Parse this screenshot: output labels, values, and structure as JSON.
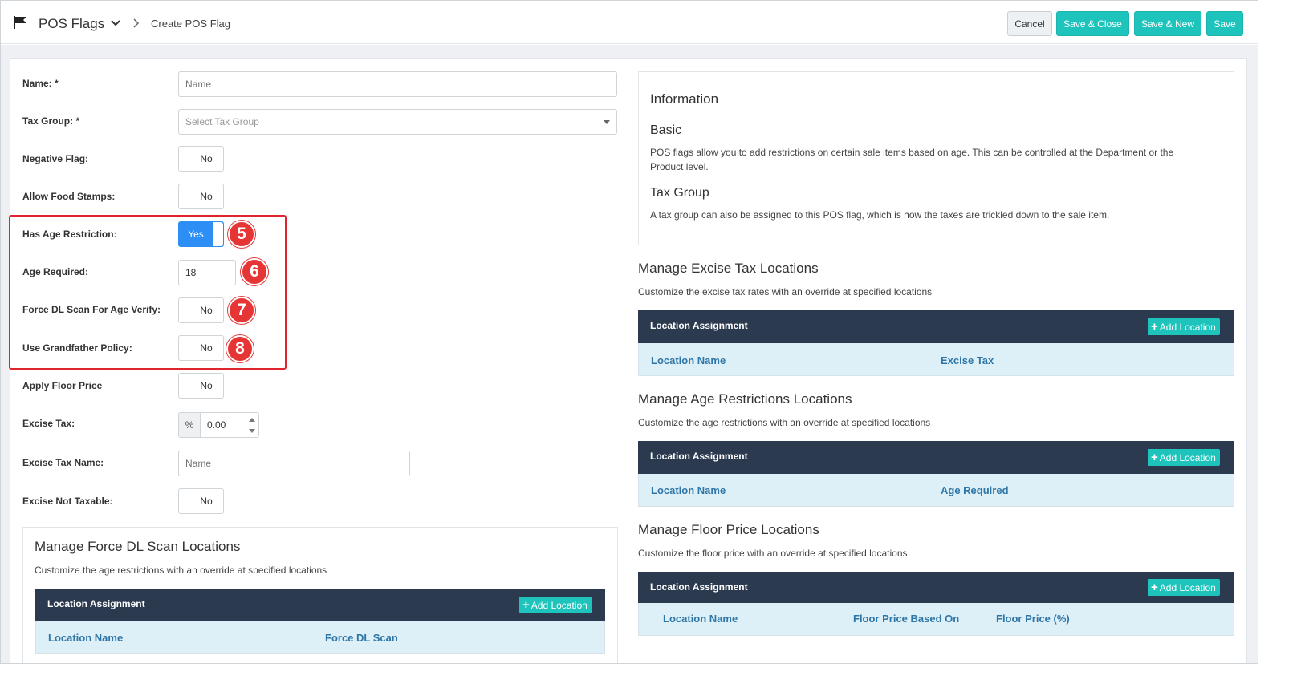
{
  "header": {
    "module_title": "POS Flags",
    "breadcrumb_page": "Create POS Flag",
    "buttons": {
      "cancel": "Cancel",
      "save_close": "Save & Close",
      "save_new": "Save & New",
      "save": "Save"
    }
  },
  "form": {
    "name": {
      "label": "Name: *",
      "placeholder": "Name"
    },
    "tax_group": {
      "label": "Tax Group: *",
      "placeholder": "Select Tax Group"
    },
    "negative_flag": {
      "label": "Negative Flag:",
      "value": "No"
    },
    "allow_food_stamps": {
      "label": "Allow Food Stamps:",
      "value": "No"
    },
    "has_age_restriction": {
      "label": "Has Age Restriction:",
      "value": "Yes"
    },
    "age_required": {
      "label": "Age Required:",
      "value": "18"
    },
    "force_dl_scan": {
      "label": "Force DL Scan For Age Verify:",
      "value": "No"
    },
    "grandfather_policy": {
      "label": "Use Grandfather Policy:",
      "value": "No"
    },
    "apply_floor_price": {
      "label": "Apply Floor Price",
      "value": "No"
    },
    "excise_tax": {
      "label": "Excise Tax:",
      "addon": "%",
      "value": "0.00"
    },
    "excise_tax_name": {
      "label": "Excise Tax Name:",
      "placeholder": "Name"
    },
    "excise_not_taxable": {
      "label": "Excise Not Taxable:",
      "value": "No"
    }
  },
  "annotations": {
    "badge_5": "5",
    "badge_6": "6",
    "badge_7": "7",
    "badge_8": "8",
    "highlight_color": "#e0242e"
  },
  "info": {
    "title": "Information",
    "basic_heading": "Basic",
    "basic_text_line1": "POS flags allow you to add restrictions on certain sale items based on age. This can be controlled at the Department or the",
    "basic_text_line2": "Product level.",
    "tax_heading": "Tax Group",
    "tax_text": "A tax group can also be assigned to this POS flag, which is how the taxes are trickled down to the sale item."
  },
  "sections": {
    "force_dl": {
      "title": "Manage Force DL Scan Locations",
      "subtitle": "Customize the age restrictions with an override at specified locations",
      "table_title": "Location Assignment",
      "add_label": "Add Location",
      "columns": [
        "Location Name",
        "Force DL Scan"
      ]
    },
    "excise": {
      "title": "Manage Excise Tax Locations",
      "subtitle": "Customize the excise tax rates with an override at specified locations",
      "table_title": "Location Assignment",
      "add_label": "Add Location",
      "columns": [
        "Location Name",
        "Excise Tax"
      ]
    },
    "age": {
      "title": "Manage Age Restrictions Locations",
      "subtitle": "Customize the age restrictions with an override at specified locations",
      "table_title": "Location Assignment",
      "add_label": "Add Location",
      "columns": [
        "Location Name",
        "Age Required"
      ]
    },
    "floor": {
      "title": "Manage Floor Price Locations",
      "subtitle": "Customize the floor price with an override at specified locations",
      "table_title": "Location Assignment",
      "add_label": "Add Location",
      "columns": [
        "Location Name",
        "Floor Price Based On",
        "Floor Price (%)"
      ]
    }
  },
  "colors": {
    "accent": "#1ec4bc",
    "toggle_on": "#2d8ef5",
    "table_header": "#2b3a4e",
    "table_columns_bg": "#def0f7",
    "column_text": "#2e76a8"
  }
}
